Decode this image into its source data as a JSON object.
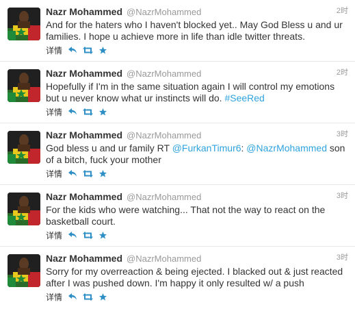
{
  "colors": {
    "link": "#2fa3de",
    "action_icon": "#2d8fc5"
  },
  "icons": [
    "reply-icon",
    "retweet-icon",
    "favorite-icon"
  ],
  "tweets": [
    {
      "name": "Nazr Mohammed",
      "handle": "@NazrMohammed",
      "time": "2时",
      "details": "详情",
      "text_parts": [
        "And for the haters who I haven't blocked yet.. May God Bless u and ur families. I hope u achieve more in life than idle twitter threats."
      ]
    },
    {
      "name": "Nazr Mohammed",
      "handle": "@NazrMohammed",
      "time": "2时",
      "details": "详情",
      "text_parts": [
        "Hopefully if I'm in the same situation again I will control my emotions but u never know what ur instincts will do. ",
        "#SeeRed"
      ]
    },
    {
      "name": "Nazr Mohammed",
      "handle": "@NazrMohammed",
      "time": "3时",
      "details": "详情",
      "text_parts": [
        "God bless u and ur family RT ",
        "@FurkanTimur6",
        ": ",
        "@NazrMohammed",
        " son of a bitch, fuck your mother"
      ]
    },
    {
      "name": "Nazr Mohammed",
      "handle": "@NazrMohammed",
      "time": "3时",
      "details": "详情",
      "text_parts": [
        "For the kids who were watching... That not the way to react on the basketball court."
      ]
    },
    {
      "name": "Nazr Mohammed",
      "handle": "@NazrMohammed",
      "time": "3时",
      "details": "详情",
      "text_parts": [
        "Sorry for my overreaction & being ejected. I blacked out & just reacted after I was pushed down. I'm happy it only resulted w/ a push"
      ]
    }
  ]
}
